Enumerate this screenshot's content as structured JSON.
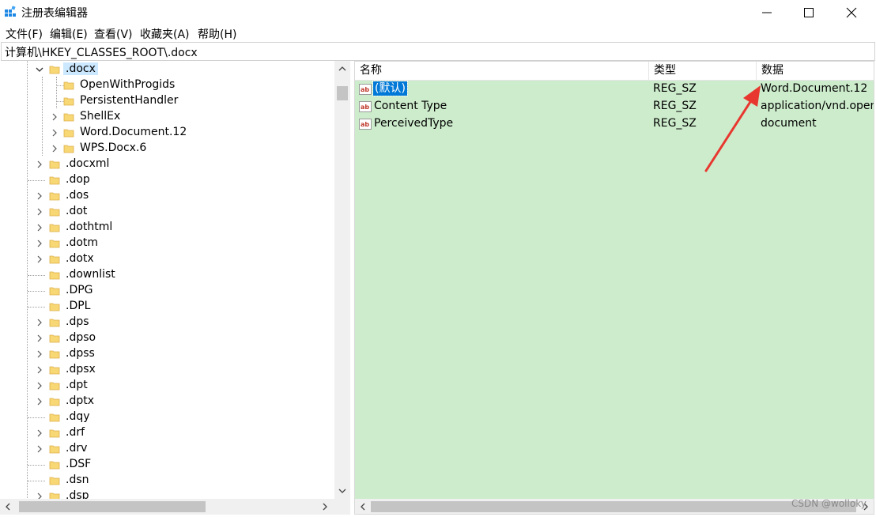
{
  "window": {
    "title": "注册表编辑器",
    "controls": {
      "minimize": "minimize-icon",
      "maximize": "maximize-icon",
      "close": "close-icon"
    }
  },
  "menu": {
    "items": [
      "文件(F)",
      "编辑(E)",
      "查看(V)",
      "收藏夹(A)",
      "帮助(H)"
    ]
  },
  "address": {
    "path": "计算机\\HKEY_CLASSES_ROOT\\.docx"
  },
  "tree": {
    "selected": ".docx",
    "rows": [
      {
        "label": ".docx",
        "expanded": true
      },
      {
        "label": "OpenWithProgids"
      },
      {
        "label": "PersistentHandler"
      },
      {
        "label": "ShellEx"
      },
      {
        "label": "Word.Document.12"
      },
      {
        "label": "WPS.Docx.6"
      },
      {
        "label": ".docxml"
      },
      {
        "label": ".dop"
      },
      {
        "label": ".dos"
      },
      {
        "label": ".dot"
      },
      {
        "label": ".dothtml"
      },
      {
        "label": ".dotm"
      },
      {
        "label": ".dotx"
      },
      {
        "label": ".downlist"
      },
      {
        "label": ".DPG"
      },
      {
        "label": ".DPL"
      },
      {
        "label": ".dps"
      },
      {
        "label": ".dpso"
      },
      {
        "label": ".dpss"
      },
      {
        "label": ".dpsx"
      },
      {
        "label": ".dpt"
      },
      {
        "label": ".dptx"
      },
      {
        "label": ".dqy"
      },
      {
        "label": ".drf"
      },
      {
        "label": ".drv"
      },
      {
        "label": ".DSF"
      },
      {
        "label": ".dsn"
      },
      {
        "label": ".dsp"
      }
    ]
  },
  "values": {
    "columns": {
      "name": "名称",
      "type": "类型",
      "data": "数据"
    },
    "rows": [
      {
        "name": "(默认)",
        "type": "REG_SZ",
        "data": "Word.Document.12",
        "selected": true
      },
      {
        "name": "Content Type",
        "type": "REG_SZ",
        "data": "application/vnd.open"
      },
      {
        "name": "PerceivedType",
        "type": "REG_SZ",
        "data": "document"
      }
    ]
  },
  "colors": {
    "list_background": "#cdeccc",
    "selection": "#0078d7",
    "tree_selection": "#cce8ff",
    "annotation_arrow": "#e8372f"
  },
  "watermark": "CSDN @wolloky"
}
